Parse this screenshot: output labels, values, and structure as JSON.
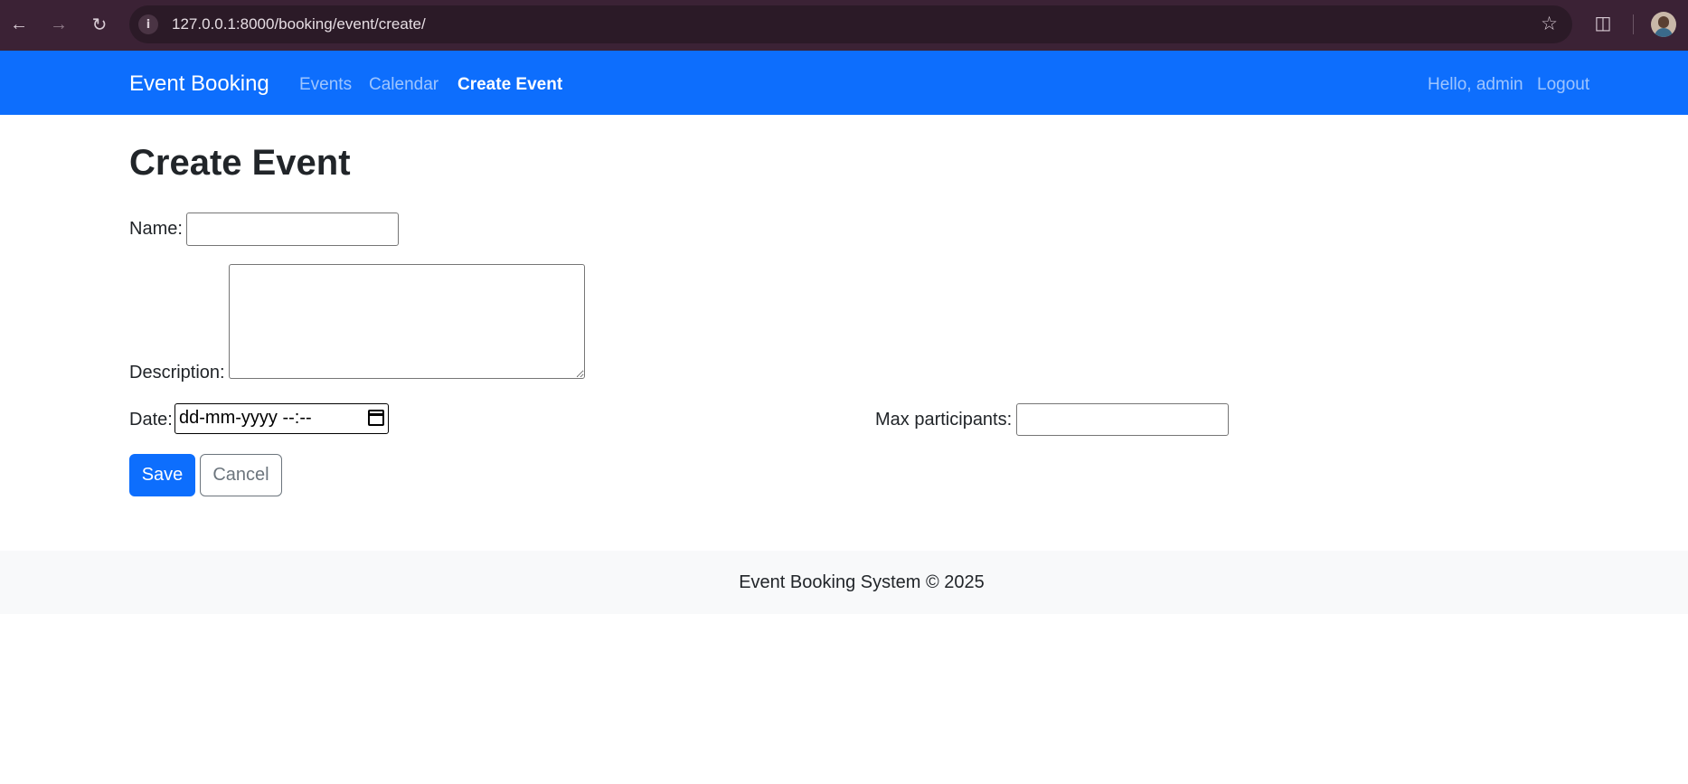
{
  "browser": {
    "url": "127.0.0.1:8000/booking/event/create/",
    "icons": [
      "back-icon",
      "forward-icon",
      "reload-icon",
      "site-info-icon",
      "bookmark-star-icon",
      "extensions-icon",
      "profile-avatar"
    ]
  },
  "navbar": {
    "brand": "Event Booking",
    "links": [
      "Events",
      "Calendar",
      "Create Event"
    ],
    "active_link": "Create Event",
    "greeting": "Hello, admin",
    "logout": "Logout",
    "color": "#0d6efd"
  },
  "page": {
    "title": "Create Event"
  },
  "form": {
    "name_label": "Name:",
    "name_value": "",
    "description_label": "Description:",
    "description_value": "",
    "date_label": "Date:",
    "date_placeholder": "dd-mm-yyyy --:--",
    "max_label": "Max participants:",
    "max_value": "",
    "save_label": "Save",
    "cancel_label": "Cancel"
  },
  "footer": {
    "text": "Event Booking System © 2025"
  }
}
